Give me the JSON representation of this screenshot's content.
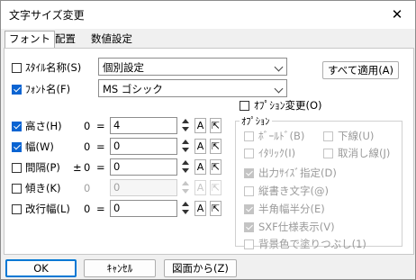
{
  "window": {
    "title": "文字サイズ変更",
    "close_glyph": "✕"
  },
  "tabs": [
    {
      "label": "フォント"
    },
    {
      "label": "配置"
    },
    {
      "label": "数値設定"
    }
  ],
  "style_name": {
    "label": "ｽﾀｲﾙ名称(S)",
    "checked": false,
    "value": "個別設定"
  },
  "apply_all_button": "すべて適用(A)",
  "font_name": {
    "label": "ﾌｫﾝﾄ名(F)",
    "checked": true,
    "value": "MS ゴシック"
  },
  "option_change": {
    "label": "ｵﾌﾟｼｮﾝ変更(O)",
    "checked": false
  },
  "rows": [
    {
      "label": "高さ(H)",
      "checked": true,
      "prefix": "",
      "left": "0",
      "eq": "=",
      "value": "4",
      "a": "A",
      "pick": "⇱",
      "disabled": false
    },
    {
      "label": "幅(W)",
      "checked": true,
      "prefix": "",
      "left": "0",
      "eq": "=",
      "value": "0",
      "a": "A",
      "pick": "⇱",
      "disabled": false
    },
    {
      "label": "間隔(P)",
      "checked": false,
      "prefix": "±",
      "left": "0",
      "eq": "=",
      "value": "0",
      "a": "A",
      "pick": "⇱",
      "disabled": false
    },
    {
      "label": "傾き(K)",
      "checked": false,
      "prefix": "",
      "left": "0",
      "eq": "",
      "value": "0",
      "a": "A",
      "pick": "⇱",
      "disabled": true
    },
    {
      "label": "改行幅(L)",
      "checked": false,
      "prefix": "",
      "left": "0",
      "eq": "=",
      "value": "0",
      "a": "A",
      "pick": "⇱",
      "disabled": false
    }
  ],
  "options_group": {
    "title": "ｵﾌﾟｼｮﾝ",
    "items": [
      {
        "label": "ﾎﾞｰﾙﾄﾞ(B)",
        "checked": false
      },
      {
        "label": "下線(U)",
        "checked": false
      },
      {
        "label": "ｲﾀﾘｯｸ(I)",
        "checked": false
      },
      {
        "label": "取消し線(J)",
        "checked": false
      },
      {
        "label": "出力ｻｲｽﾞ指定(D)",
        "checked": true
      },
      {
        "label": "縦書き文字(@)",
        "checked": false
      },
      {
        "label": "半角幅半分(E)",
        "checked": true
      },
      {
        "label": "SXF仕様表示(V)",
        "checked": true
      },
      {
        "label": "背景色で塗りつぶし(1)",
        "checked": false
      }
    ]
  },
  "footer": {
    "ok": "OK",
    "cancel": "ｷｬﾝｾﾙ",
    "from_drawing": "図面から(Z)"
  }
}
